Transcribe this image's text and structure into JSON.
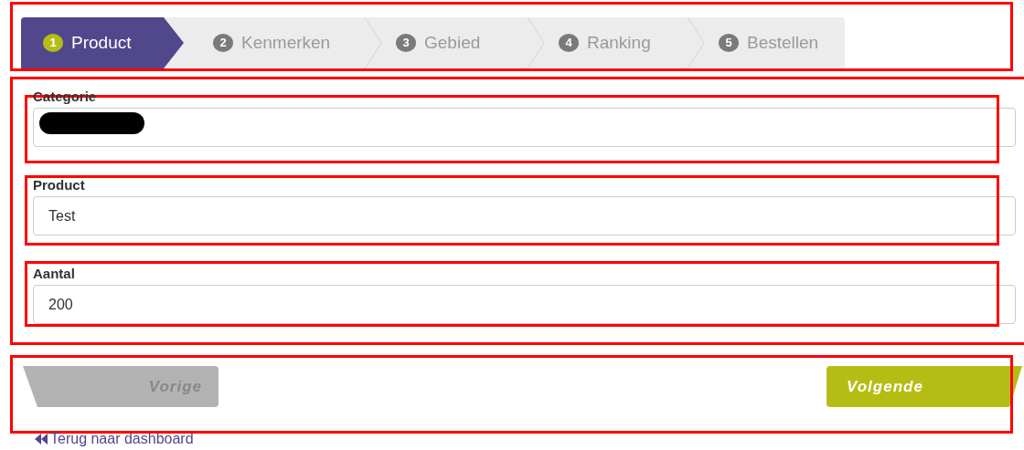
{
  "steps": [
    {
      "number": "1",
      "label": "Product",
      "selected": true
    },
    {
      "number": "2",
      "label": "Kenmerken",
      "selected": false
    },
    {
      "number": "3",
      "label": "Gebied",
      "selected": false
    },
    {
      "number": "4",
      "label": "Ranking",
      "selected": false
    },
    {
      "number": "5",
      "label": "Bestellen",
      "selected": false
    }
  ],
  "fields": [
    {
      "label": "Categorie",
      "redacted": true
    },
    {
      "label": "Product",
      "value": "Test",
      "redacted": false
    },
    {
      "label": "Aantal",
      "value": "200",
      "redacted": false
    }
  ],
  "buttons": [
    {
      "label": "Vorige",
      "kind": "back",
      "disabled": true
    },
    {
      "label": "Volgende",
      "kind": "next",
      "disabled": false
    }
  ],
  "back_link": {
    "label": "Terug naar dashboard"
  }
}
